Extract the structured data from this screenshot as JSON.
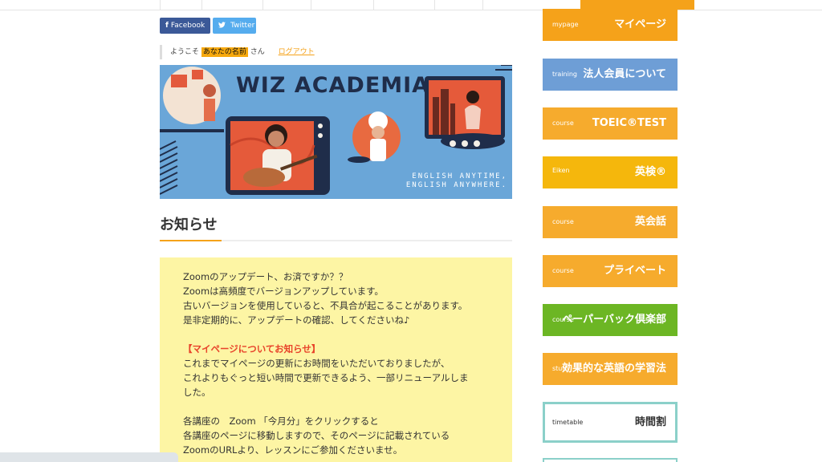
{
  "social": {
    "facebook": {
      "icon": "f",
      "label": "Facebook"
    },
    "twitter": {
      "icon": "🐦",
      "label": "Twitter"
    }
  },
  "welcome": {
    "prefix": "ようこそ",
    "name": "あなたの名前",
    "suffix": "さん",
    "logout": "ログアウト"
  },
  "banner": {
    "title": "WIZ ACADEMIA",
    "sub1": "ENGLISH ANYTIME,",
    "sub2": "ENGLISH ANYWHERE."
  },
  "section": {
    "title": "お知らせ"
  },
  "notice": {
    "lines": [
      "Zoomのアップデート、お済ですか？？",
      "Zoomは高頻度でバージョンアップしています。",
      "古いバージョンを使用していると、不具合が起こることがあります。",
      "是非定期的に、アップデートの確認、してくださいね♪",
      "",
      "【マイページについてお知らせ】",
      "これまでマイページの更新にお時間をいただいておりましたが、",
      "これよりもぐっと短い時間で更新できるよう、一部リニューアルしま",
      "した。",
      "",
      "各講座の　Zoom 「今月分」をクリックすると",
      "各講座のページに移動しますので、そのページに記載されている",
      "ZoomのURLより、レッスンにご参加くださいませ。"
    ]
  },
  "sidebar": {
    "items": [
      {
        "small": "mypage",
        "big": "マイページ"
      },
      {
        "small": "training",
        "big": "法人会員について"
      },
      {
        "small": "course",
        "big": "TOEIC®TEST"
      },
      {
        "small": "Eiken",
        "big": "英検®"
      },
      {
        "small": "course",
        "big": "英会話"
      },
      {
        "small": "course",
        "big": "プライベート"
      },
      {
        "small": "course",
        "big": "ペーパーバック倶楽部"
      },
      {
        "small": "study",
        "big": "効果的な英語の学習法"
      },
      {
        "small": "timetable",
        "big": "時間割"
      }
    ]
  },
  "colors": {
    "accent": "#f5a21a",
    "notice_bg": "#fdf5a4",
    "banner_bg": "#6aa6d8"
  }
}
